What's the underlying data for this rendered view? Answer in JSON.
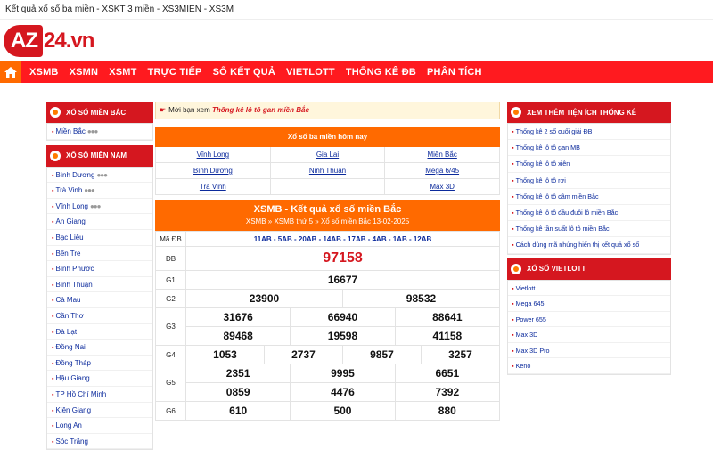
{
  "window": {
    "title": "Kết quả xổ số ba miền - XSKT 3 miền - XS3MIEN - XS3M"
  },
  "logo": {
    "part1": "AZ",
    "part2": "24.vn"
  },
  "nav": {
    "home_icon": "home-icon",
    "items": [
      "XSMB",
      "XSMN",
      "XSMT",
      "TRỰC TIẾP",
      "SỐ KẾT QUẢ",
      "VIETLOTT",
      "THỐNG KÊ ĐB",
      "PHÂN TÍCH"
    ]
  },
  "left": {
    "north_title": "XỔ SỐ MIỀN BẮC",
    "north_items": [
      "Miền Bắc"
    ],
    "south_title": "XỔ SỐ MIỀN NAM",
    "south_items": [
      "Bình Dương",
      "Trà Vinh",
      "Vĩnh Long",
      "An Giang",
      "Bạc Liêu",
      "Bến Tre",
      "Bình Phước",
      "Bình Thuận",
      "Cà Mau",
      "Cần Thơ",
      "Đà Lạt",
      "Đồng Nai",
      "Đồng Tháp",
      "Hậu Giang",
      "TP Hồ Chí Minh",
      "Kiên Giang",
      "Long An",
      "Sóc Trăng"
    ],
    "dots": "●●●"
  },
  "notice": {
    "prefix": "Mời bạn xem",
    "link": "Thống kê lô tô gan miền Bắc"
  },
  "today": {
    "title": "Xổ số ba miền hôm nay",
    "rows": [
      [
        "Vĩnh Long",
        "Gia Lai",
        "Miền Bắc"
      ],
      [
        "Bình Dương",
        "Ninh Thuận",
        "Mega 6/45"
      ],
      [
        "Trà Vinh",
        "",
        "Max 3D"
      ]
    ]
  },
  "result": {
    "title": "XSMB - Kết quả xổ số miền Bắc",
    "crumb1": "XSMB",
    "sep": "»",
    "crumb2": "XSMB thứ 5",
    "crumb3": "Xổ số miền Bắc 13-02-2025",
    "ma_db_label": "Mã ĐB",
    "ma_db": "11AB - 5AB - 20AB - 14AB - 17AB - 4AB - 1AB - 12AB",
    "labels": {
      "db": "ĐB",
      "g1": "G1",
      "g2": "G2",
      "g3": "G3",
      "g4": "G4",
      "g5": "G5",
      "g6": "G6"
    },
    "db": "97158",
    "g1": "16677",
    "g2": [
      "23900",
      "98532"
    ],
    "g3": [
      "31676",
      "66940",
      "88641",
      "89468",
      "19598",
      "41158"
    ],
    "g4": [
      "1053",
      "2737",
      "9857",
      "3257"
    ],
    "g5": [
      "2351",
      "9995",
      "6651",
      "0859",
      "4476",
      "7392"
    ],
    "g6": [
      "610",
      "500",
      "880"
    ]
  },
  "right": {
    "tools_title": "XEM THÊM TIỆN ÍCH THỐNG KÊ",
    "tools": [
      "Thống kê 2 số cuối giải ĐB",
      "Thống kê lô tô gan MB",
      "Thống kê lô tô xiên",
      "Thống kê lô tô rơi",
      "Thống kê lô tô câm miền Bắc",
      "Thống kê lô tô đầu đuôi lô miền Bắc",
      "Thống kê tần suất lô tô miền Bắc",
      "Cách dùng mã nhúng hiển thị kết quả xổ số"
    ],
    "vietlott_title": "XỔ SỐ VIETLOTT",
    "vietlott": [
      "Vietlott",
      "Mega 645",
      "Power 655",
      "Max 3D",
      "Max 3D Pro",
      "Keno"
    ]
  },
  "colors": {
    "brand_red": "#d5171f",
    "nav_red": "#ff1a1f",
    "orange": "#ff6a00",
    "link_blue": "#0b2a9c"
  }
}
